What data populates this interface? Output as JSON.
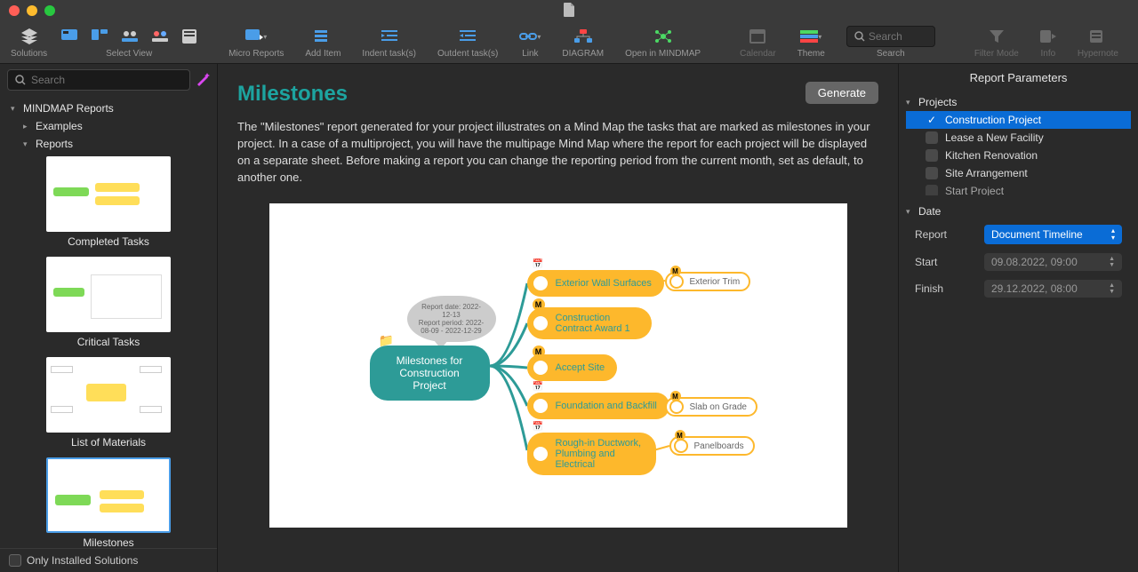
{
  "titlebar": {
    "icon": "document"
  },
  "toolbar": {
    "solutions": "Solutions",
    "select_view": "Select View",
    "micro_reports": "Micro Reports",
    "add_item": "Add Item",
    "indent": "Indent task(s)",
    "outdent": "Outdent task(s)",
    "link": "Link",
    "diagram": "DIAGRAM",
    "open_mindmap": "Open in MINDMAP",
    "calendar": "Calendar",
    "theme": "Theme",
    "search": "Search",
    "search_placeholder": "Search",
    "filter_mode": "Filter Mode",
    "info": "Info",
    "hypernote": "Hypernote"
  },
  "sidebar": {
    "search_placeholder": "Search",
    "root": "MINDMAP Reports",
    "examples": "Examples",
    "reports": "Reports",
    "thumbs": [
      {
        "label": "Completed Tasks"
      },
      {
        "label": "Critical Tasks"
      },
      {
        "label": "List of Materials"
      },
      {
        "label": "Milestones"
      }
    ],
    "footer": "Only Installed Solutions"
  },
  "main": {
    "title": "Milestones",
    "generate": "Generate",
    "description": "The \"Milestones\" report generated for your project illustrates on a Mind Map the tasks that are marked as milestones in your project. In a case of a multiproject, you will have the multipage Mind Map where the report for each project will be displayed on a separate sheet. Before making a report you can change the reporting period from the current month, set as default, to another one."
  },
  "mindmap": {
    "bubble_line1": "Report date: 2022-12-13",
    "bubble_line2": "Report period: 2022-08-09 - 2022-12-29",
    "root_line1": "Milestones for",
    "root_line2": "Construction Project",
    "branches": [
      {
        "label": "Exterior Wall Surfaces",
        "leaf": "Exterior Trim"
      },
      {
        "label": "Construction Contract Award 1"
      },
      {
        "label": "Accept Site"
      },
      {
        "label": "Foundation and Backfill",
        "leaf": "Slab on Grade"
      },
      {
        "label": "Rough-in Ductwork, Plumbing and Electrical",
        "leaf": "Panelboards"
      }
    ]
  },
  "panel": {
    "title": "Report Parameters",
    "projects_label": "Projects",
    "projects": [
      "Construction Project",
      "Lease a New Facility",
      "Kitchen Renovation",
      "Site Arrangement",
      "Start Project"
    ],
    "date_label": "Date",
    "report_label": "Report",
    "report_value": "Document Timeline",
    "start_label": "Start",
    "start_value": "09.08.2022, 09:00",
    "finish_label": "Finish",
    "finish_value": "29.12.2022, 08:00"
  }
}
